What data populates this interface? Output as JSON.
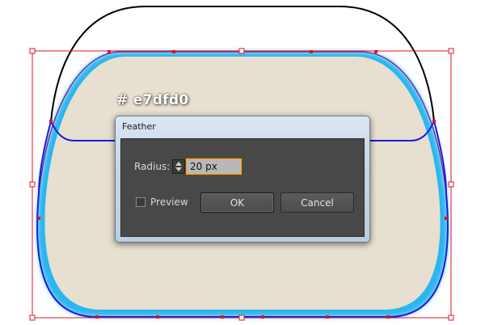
{
  "canvas": {
    "fill_color": "#e7dfd0",
    "glow_color": "#2cb6ef",
    "selection_color": "#e0141e",
    "path_color_blue": "#1a1adf",
    "path_color_black": "#000000"
  },
  "color_label": "# e7dfd0",
  "dialog": {
    "title": "Feather",
    "radius_label": "Radius:",
    "radius_value": "20 px",
    "preview_label": "Preview",
    "preview_checked": false,
    "ok_label": "OK",
    "cancel_label": "Cancel"
  }
}
